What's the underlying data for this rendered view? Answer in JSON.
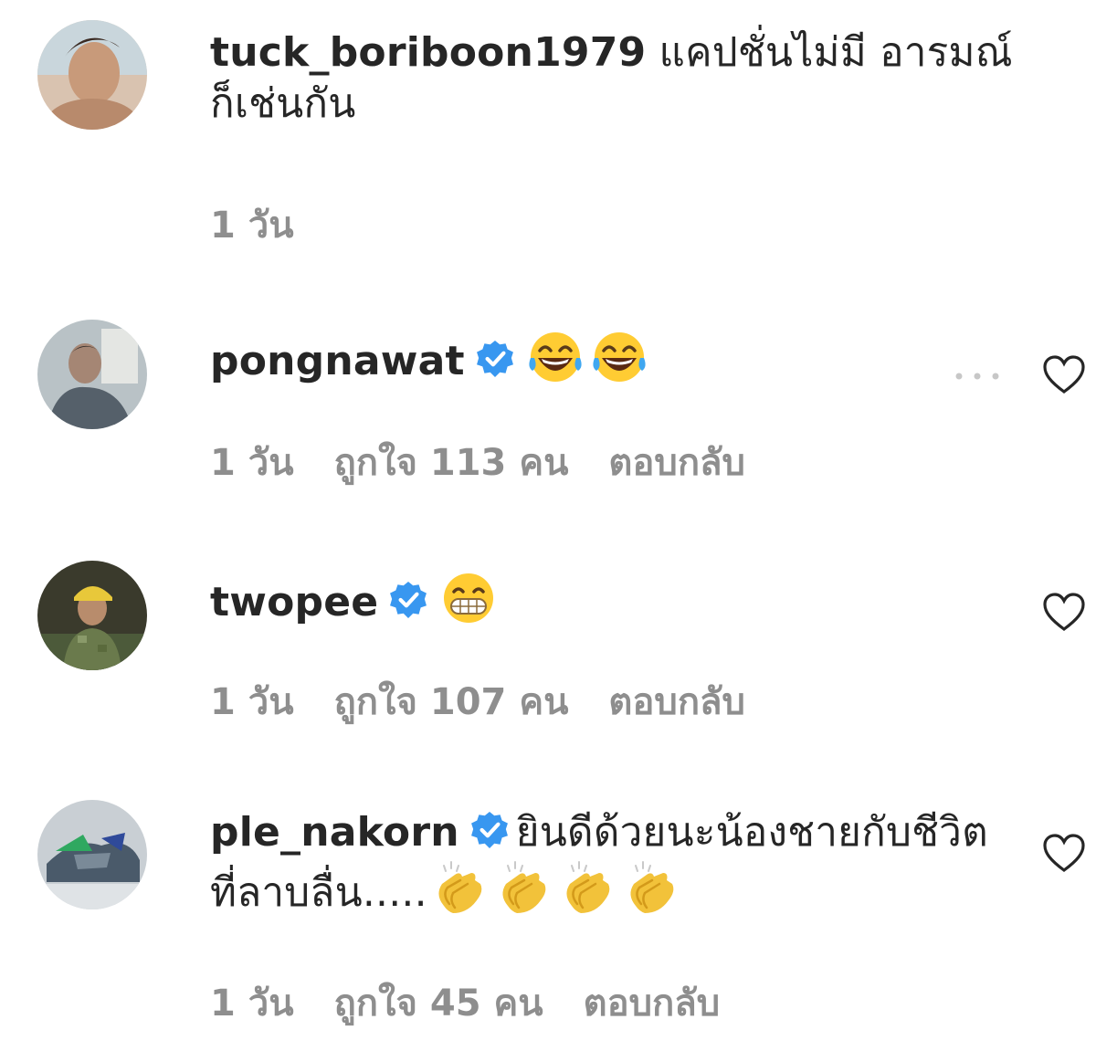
{
  "comments": [
    {
      "username": "tuck_boriboon1979",
      "verified": false,
      "text": " แคปชั่นไม่มี อารมณ์ก็เช่นกัน",
      "emojis": [],
      "time": "1 วัน",
      "likes": "",
      "reply": ""
    },
    {
      "username": "pongnawat",
      "verified": true,
      "text": "",
      "emojis": [
        "face-with-tears-of-joy-icon",
        "face-with-tears-of-joy-icon"
      ],
      "time": "1 วัน",
      "likes": "ถูกใจ 113 คน",
      "reply": "ตอบกลับ"
    },
    {
      "username": "twopee",
      "verified": true,
      "text": "",
      "emojis": [
        "grimacing-face-icon"
      ],
      "time": "1 วัน",
      "likes": "ถูกใจ 107 คน",
      "reply": "ตอบกลับ"
    },
    {
      "username": "ple_nakorn",
      "verified": true,
      "text": "ยินดีด้วยนะน้องชายกับชีวิตที่ลาบลื่น.....",
      "emojis": [
        "clapping-hands-icon",
        "clapping-hands-icon",
        "clapping-hands-icon",
        "clapping-hands-icon"
      ],
      "time": "1 วัน",
      "likes": "ถูกใจ 45 คน",
      "reply": "ตอบกลับ"
    }
  ],
  "colors": {
    "text": "#262626",
    "meta": "#8e8e8e",
    "verified": "#3897f0"
  }
}
